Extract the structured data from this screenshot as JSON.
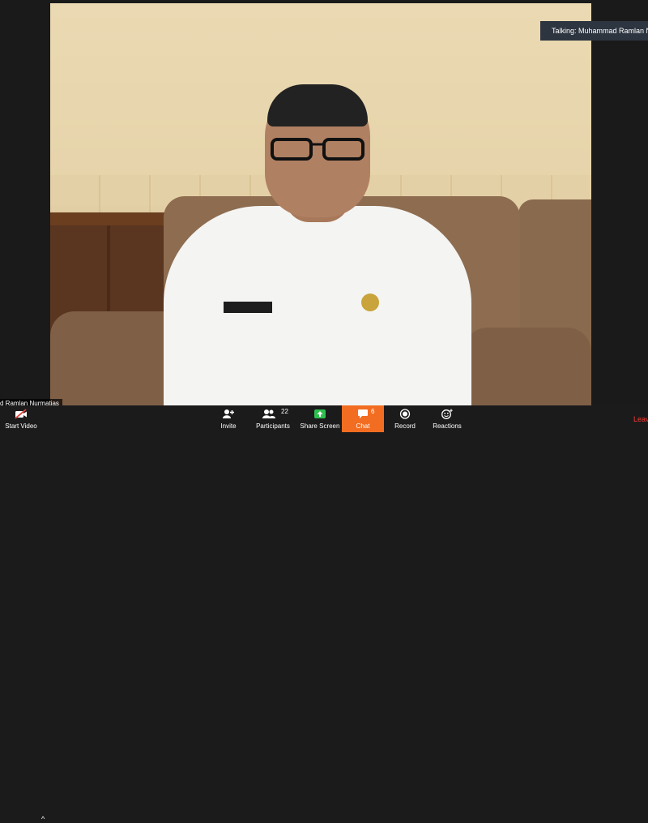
{
  "talking_banner": "Talking: Muhammad Ramlan Nurmatias",
  "participant_name_label": "d Ramlan Nurmatias",
  "toolbar": {
    "start_video": "Start Video",
    "invite": "Invite",
    "participants": "Participants",
    "participants_count": "22",
    "share_screen": "Share Screen",
    "chat": "Chat",
    "chat_count": "6",
    "record": "Record",
    "reactions": "Reactions",
    "leave": "Leave"
  },
  "colors": {
    "toolbar_bg": "#1b1b1c",
    "chat_active": "#f26d21",
    "share_green": "#2ec04f",
    "leave_red": "#ff3b30"
  },
  "icons": [
    "video-off-icon",
    "invite-icon",
    "participants-icon",
    "share-screen-icon",
    "chat-icon",
    "record-icon",
    "reactions-icon",
    "caret-up-icon"
  ]
}
